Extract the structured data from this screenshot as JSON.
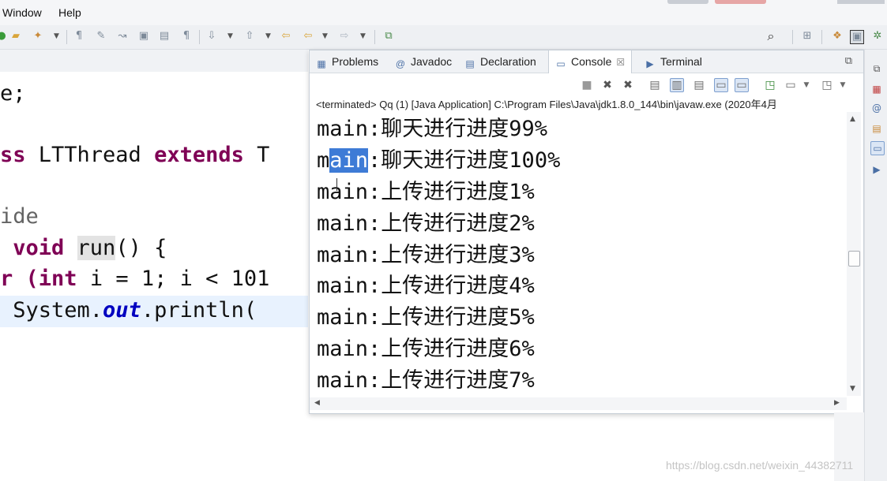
{
  "menubar": {
    "items": [
      "Window",
      "Help"
    ]
  },
  "editor": {
    "lines": {
      "l1": "e;",
      "l2_kw": "ss",
      "l2_name": " LTThread ",
      "l2_kw2": "extends",
      "l2_tail": " T",
      "l3": "ide",
      "l4_kw": " void",
      "l4_run": "run",
      "l4_tail": "() {",
      "l5_pre": "r (",
      "l5_kw": "int",
      "l5_mid": " i = 1; i < 101",
      "l6_pre": " System.",
      "l6_field": "out",
      "l6_tail": ".println("
    }
  },
  "view": {
    "tabs": {
      "problems": "Problems",
      "javadoc": "Javadoc",
      "declaration": "Declaration",
      "console": "Console",
      "terminal": "Terminal"
    },
    "close_glyph": "☒",
    "process_label": "<terminated> Qq (1) [Java Application] C:\\Program Files\\Java\\jdk1.8.0_144\\bin\\javaw.exe  (2020年4月",
    "output": [
      {
        "pre": "main:",
        "text": "聊天进行进度99%"
      },
      {
        "pre_a": "m",
        "selected": "ain",
        "text": ":聊天进行进度100%"
      },
      {
        "pre": "main:",
        "text": "上传进行进度1%"
      },
      {
        "pre": "main:",
        "text": "上传进行进度2%"
      },
      {
        "pre": "main:",
        "text": "上传进行进度3%"
      },
      {
        "pre": "main:",
        "text": "上传进行进度4%"
      },
      {
        "pre": "main:",
        "text": "上传进行进度5%"
      },
      {
        "pre": "main:",
        "text": "上传进行进度6%"
      },
      {
        "pre": "main:",
        "text": "上传进行进度7%"
      }
    ]
  },
  "watermark": "https://blog.csdn.net/weixin_44382711",
  "colors": {
    "keyword": "#7f0055",
    "static_field": "#0000c0",
    "selection": "#3e7bd6",
    "current_line": "#e8f2fe"
  },
  "icons": {
    "toolbar": [
      "open-folder-icon",
      "launch-icon",
      "annotation-icon",
      "marker-icon",
      "arrow-icon",
      "bookmark-icon",
      "page-icon",
      "pilcrow-icon",
      "next-annotation-icon",
      "prev-annotation-icon",
      "back-icon",
      "back-arrow-icon",
      "forward-icon",
      "open-view-icon",
      "search-icon",
      "perspective-icon",
      "java-perspective-icon",
      "debug-perspective-icon"
    ],
    "console_toolbar": [
      "terminate-icon",
      "remove-launch-icon",
      "remove-all-icon",
      "clear-console-icon",
      "scroll-lock-icon",
      "word-wrap-icon",
      "show-stdout-icon",
      "show-stderr-icon",
      "pin-console-icon",
      "display-console-icon",
      "open-console-icon"
    ]
  }
}
